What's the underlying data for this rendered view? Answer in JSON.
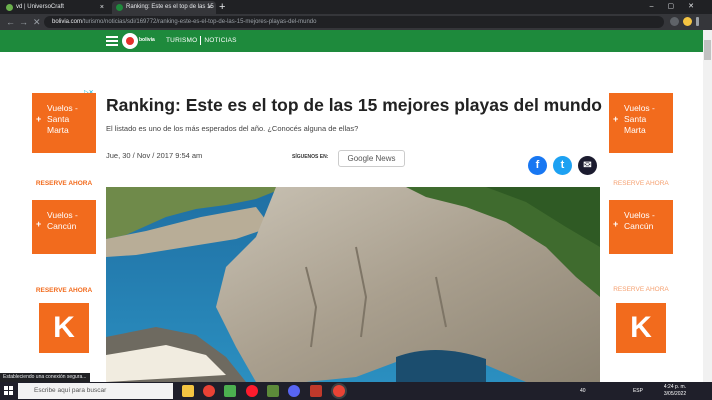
{
  "browser": {
    "tabs": [
      {
        "title": "vd | UniversoCraft",
        "close": "×"
      },
      {
        "title": "Ranking: Este es el top de las 15",
        "close": "×"
      }
    ],
    "new_tab": "+",
    "window_controls": "–▢✕",
    "nav": {
      "back": "←",
      "forward": "→",
      "reload": "✕"
    },
    "url_host": "bolivia.com",
    "url_path": "/turismo/noticias/sdi/169772/ranking-este-es-el-top-de-las-15-mejores-playas-del-mundo"
  },
  "site": {
    "logo_text": "bolivia",
    "nav": {
      "turismo": "TURISMO",
      "noticias": "NOTICIAS"
    }
  },
  "ads": {
    "choices_label": "▷✕",
    "left": [
      {
        "line1": "Vuelos -",
        "line2": "Santa",
        "line3": "Marta",
        "cta": "RESERVE AHORA"
      },
      {
        "line1": "Vuelos -",
        "line2": "Cancún",
        "line3": "",
        "cta": "RESERVE AHORA"
      }
    ],
    "right": [
      {
        "line1": "Vuelos -",
        "line2": "Santa",
        "line3": "Marta",
        "cta": "RESERVE AHORA"
      },
      {
        "line1": "Vuelos -",
        "line2": "Cancún",
        "line3": "",
        "cta": "RESERVE AHORA"
      }
    ],
    "plus": "+",
    "k_logo": "K"
  },
  "article": {
    "title": "Ranking: Este es el top de las 15 mejores playas del mundo",
    "subtitle": "El listado es uno de los más esperados del año. ¿Conocés alguna de ellas?",
    "date": "Jue, 30 / Nov / 2017 9:54 am",
    "follow_label": "SÍGUENOS EN:",
    "google_news": "Google News",
    "share": {
      "facebook": "f",
      "twitter": "t",
      "email": "✉"
    }
  },
  "status_text": "Estableciendo una conexión segura...",
  "taskbar": {
    "search_placeholder": "Escribe aquí para buscar",
    "tray": {
      "temp": "40",
      "lang": "ESP"
    },
    "time": "4:24 p. m.",
    "date": "3/05/2022"
  },
  "colors": {
    "site_green": "#1e8a3c",
    "ad_orange": "#f26b1d",
    "facebook": "#1877f2",
    "twitter": "#1da1f2",
    "email": "#1b1b2f"
  }
}
